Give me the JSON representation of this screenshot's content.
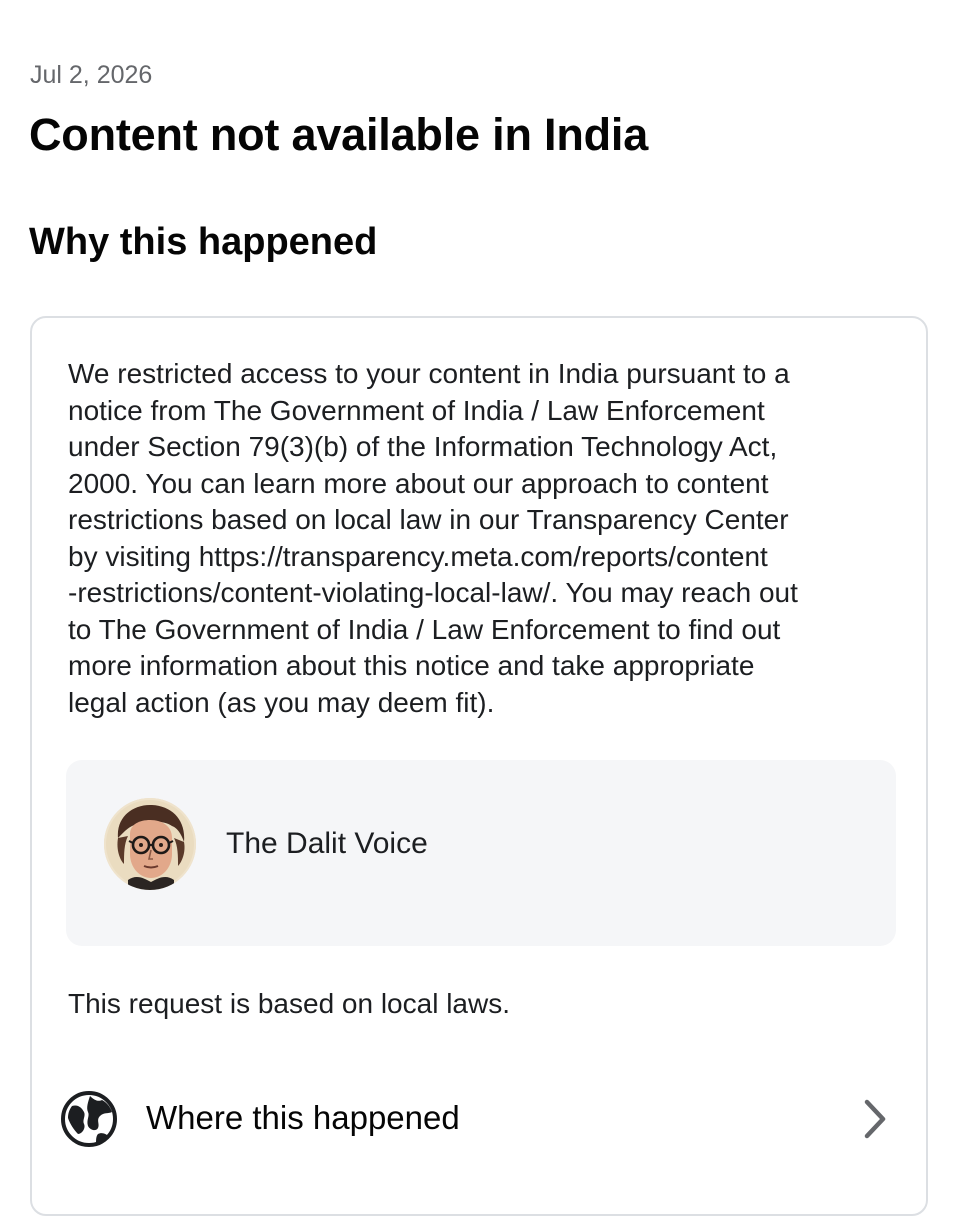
{
  "header": {
    "date": "Jul 2, 2026",
    "title": "Content not available in India"
  },
  "section": {
    "title": "Why this happened"
  },
  "notice": {
    "lines": [
      "We restricted access to your content in India pursuant to a",
      "notice from The Government of India / Law Enforcement",
      "under Section 79(3)(b) of the Information Technology Act,",
      "2000. You can learn more about our approach to content",
      "restrictions based on local law in our Transparency Center",
      "by visiting https://transparency.meta.com/reports/content",
      "-restrictions/content-violating-local-law/. You may reach out",
      "to The Government of India / Law Enforcement to find out",
      "more information about this notice and take appropriate",
      "legal action (as you may deem fit)."
    ]
  },
  "account": {
    "name": "The Dalit Voice",
    "avatar_icon": "person-portrait-avatar"
  },
  "basis_text": "This request is based on local laws.",
  "where_row": {
    "label": "Where this happened",
    "icon": "globe-icon",
    "chevron": "chevron-right-icon"
  }
}
